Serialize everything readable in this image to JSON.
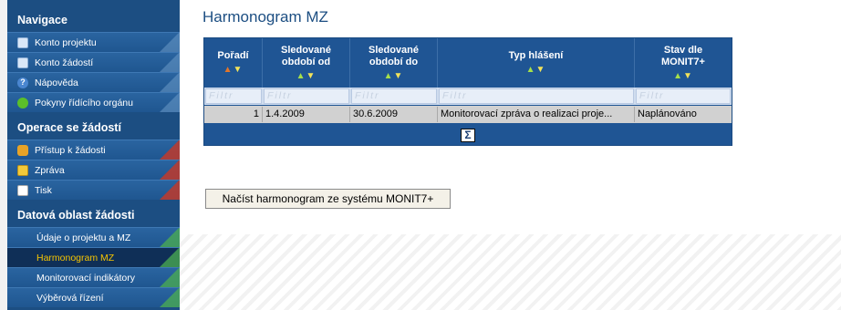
{
  "sidebar": {
    "sections": [
      {
        "title": "Navigace"
      },
      {
        "title": "Operace se žádostí"
      },
      {
        "title": "Datová oblast žádosti"
      }
    ],
    "nav_items": [
      {
        "label": "Konto projektu",
        "icon": "document-icon"
      },
      {
        "label": "Konto žádostí",
        "icon": "document-icon"
      },
      {
        "label": "Nápověda",
        "icon": "help-icon"
      },
      {
        "label": "Pokyny řídícího orgánu",
        "icon": "smiley-icon"
      }
    ],
    "op_items": [
      {
        "label": "Přístup k žádosti",
        "icon": "users-icon"
      },
      {
        "label": "Zpráva",
        "icon": "mail-icon"
      },
      {
        "label": "Tisk",
        "icon": "print-icon"
      }
    ],
    "data_items": [
      {
        "label": "Údaje o projektu a MZ"
      },
      {
        "label": "Harmonogram MZ",
        "active": true
      },
      {
        "label": "Monitorovací indikátory"
      },
      {
        "label": "Výběrová řízení"
      }
    ]
  },
  "main": {
    "title": "Harmonogram MZ",
    "grid": {
      "columns": [
        {
          "label": "Pořadí"
        },
        {
          "label_line1": "Sledované",
          "label_line2": "období od"
        },
        {
          "label_line1": "Sledované",
          "label_line2": "období do"
        },
        {
          "label": "Typ hlášení"
        },
        {
          "label_line1": "Stav dle",
          "label_line2": "MONIT7+"
        }
      ],
      "filter_placeholder": "Filtr",
      "rows": [
        {
          "poradi": "1",
          "od": "1.4.2009",
          "do": "30.6.2009",
          "typ": "Monitorovací zpráva o realizaci proje...",
          "stav": "Naplánováno"
        }
      ],
      "sum_icon": "Σ"
    },
    "load_button": "Načíst harmonogram ze systému MONIT7+"
  },
  "colors": {
    "sidebar_bg": "#1c4e82",
    "grid_header_bg": "#1f5594",
    "active_item_text": "#f6c400",
    "title_color": "#1c4e82"
  }
}
